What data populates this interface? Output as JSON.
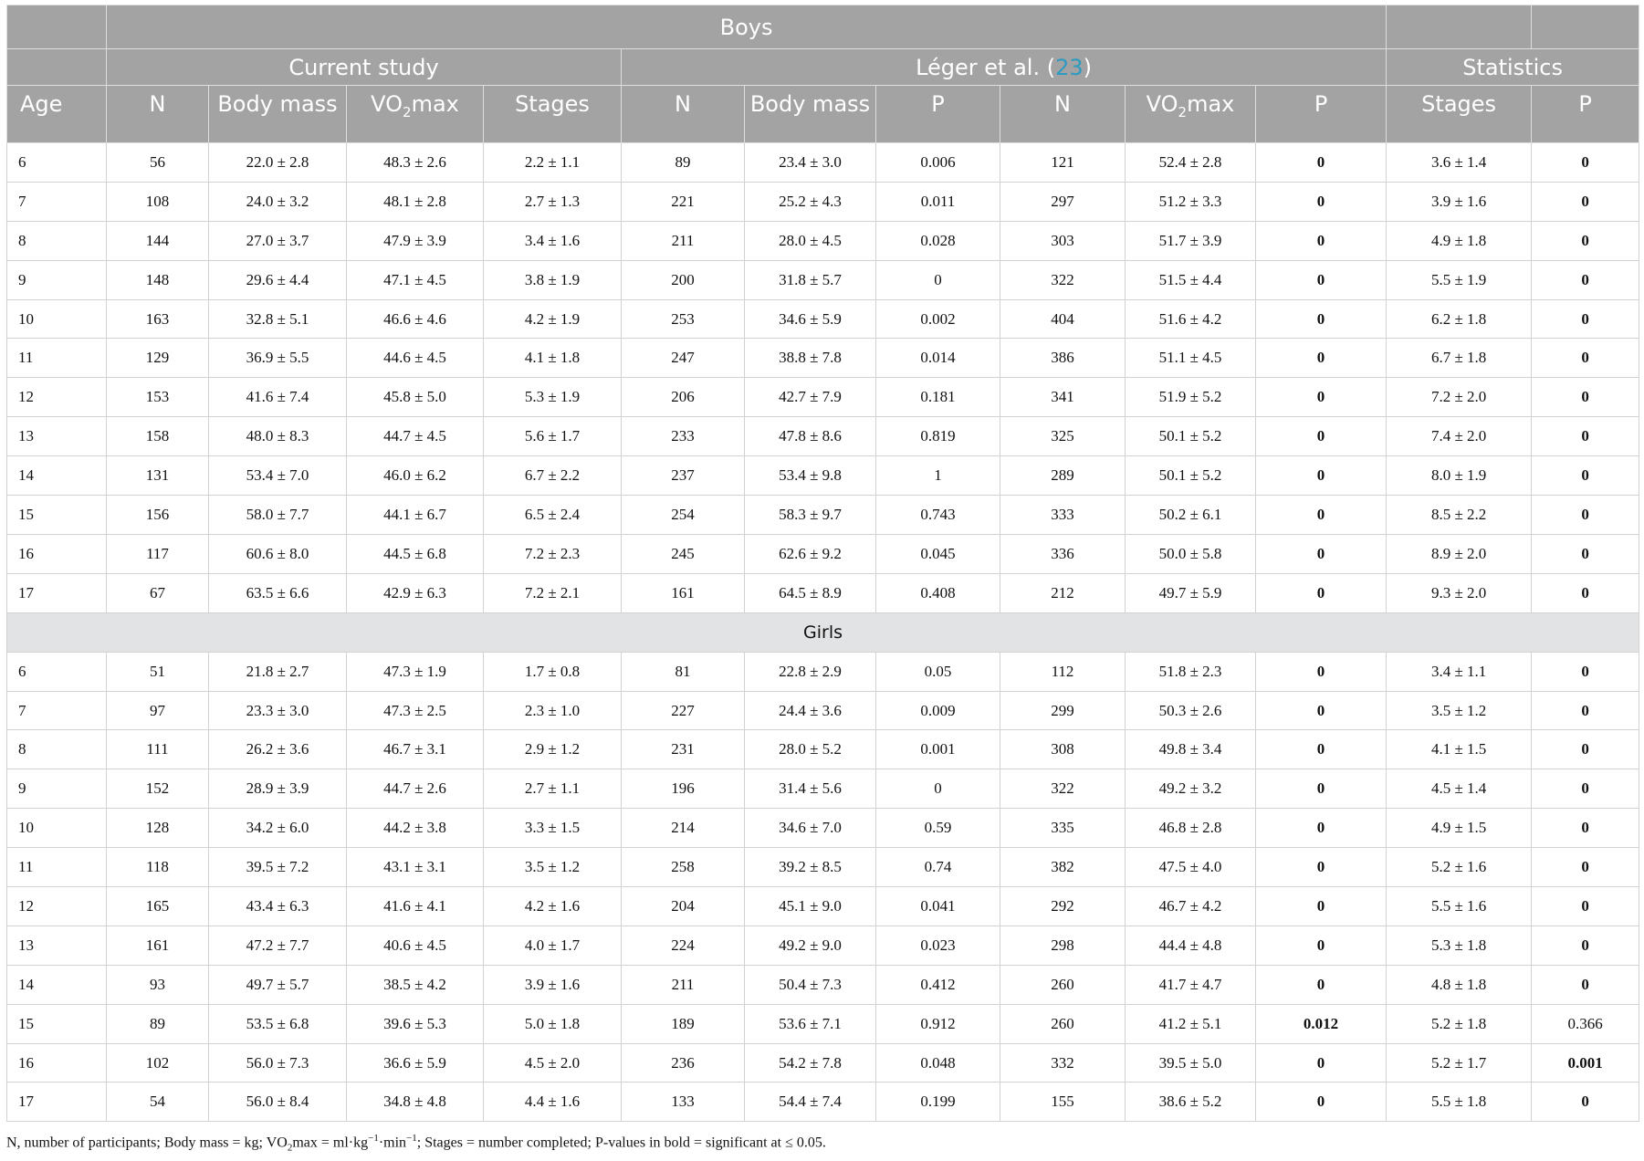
{
  "header": {
    "boys": "Boys",
    "current_study": "Current study",
    "leger_text": "Léger et al. (",
    "leger_ref": "23",
    "leger_close": ")",
    "statistics": "Statistics",
    "columns": {
      "age": "Age",
      "n1": "N",
      "body_mass_1": "Body mass",
      "vo2_prefix": "VO",
      "vo2_sub": "2",
      "vo2_suffix": "max",
      "stages1": "Stages",
      "n2": "N",
      "body_mass_2": "Body mass",
      "p1": "P",
      "n3": "N",
      "p2": "P",
      "stages2": "Stages",
      "p3": "P"
    }
  },
  "girls_label": "Girls",
  "boys_rows": [
    {
      "age": "6",
      "n": "56",
      "bm": "22.0 ± 2.8",
      "vo2": "48.3 ± 2.6",
      "st": "2.2 ± 1.1",
      "ln": "89",
      "lbm": "23.4 ± 3.0",
      "p1": "0.006",
      "ln2": "121",
      "lvo2": "52.4 ± 2.8",
      "p2": "0",
      "lst": "3.6 ± 1.4",
      "p3": "0"
    },
    {
      "age": "7",
      "n": "108",
      "bm": "24.0 ± 3.2",
      "vo2": "48.1 ± 2.8",
      "st": "2.7 ± 1.3",
      "ln": "221",
      "lbm": "25.2 ± 4.3",
      "p1": "0.011",
      "ln2": "297",
      "lvo2": "51.2 ± 3.3",
      "p2": "0",
      "lst": "3.9 ± 1.6",
      "p3": "0"
    },
    {
      "age": "8",
      "n": "144",
      "bm": "27.0 ± 3.7",
      "vo2": "47.9 ± 3.9",
      "st": "3.4 ± 1.6",
      "ln": "211",
      "lbm": "28.0 ± 4.5",
      "p1": "0.028",
      "ln2": "303",
      "lvo2": "51.7 ± 3.9",
      "p2": "0",
      "lst": "4.9 ± 1.8",
      "p3": "0"
    },
    {
      "age": "9",
      "n": "148",
      "bm": "29.6 ± 4.4",
      "vo2": "47.1 ± 4.5",
      "st": "3.8 ± 1.9",
      "ln": "200",
      "lbm": "31.8 ± 5.7",
      "p1": "0",
      "ln2": "322",
      "lvo2": "51.5 ± 4.4",
      "p2": "0",
      "lst": "5.5 ± 1.9",
      "p3": "0"
    },
    {
      "age": "10",
      "n": "163",
      "bm": "32.8 ± 5.1",
      "vo2": "46.6 ± 4.6",
      "st": "4.2 ± 1.9",
      "ln": "253",
      "lbm": "34.6 ± 5.9",
      "p1": "0.002",
      "ln2": "404",
      "lvo2": "51.6 ± 4.2",
      "p2": "0",
      "lst": "6.2 ± 1.8",
      "p3": "0"
    },
    {
      "age": "11",
      "n": "129",
      "bm": "36.9 ± 5.5",
      "vo2": "44.6 ± 4.5",
      "st": "4.1 ± 1.8",
      "ln": "247",
      "lbm": "38.8 ± 7.8",
      "p1": "0.014",
      "ln2": "386",
      "lvo2": "51.1 ± 4.5",
      "p2": "0",
      "lst": "6.7 ± 1.8",
      "p3": "0"
    },
    {
      "age": "12",
      "n": "153",
      "bm": "41.6 ± 7.4",
      "vo2": "45.8 ± 5.0",
      "st": "5.3 ± 1.9",
      "ln": "206",
      "lbm": "42.7 ± 7.9",
      "p1": "0.181",
      "ln2": "341",
      "lvo2": "51.9 ± 5.2",
      "p2": "0",
      "lst": "7.2 ± 2.0",
      "p3": "0"
    },
    {
      "age": "13",
      "n": "158",
      "bm": "48.0 ± 8.3",
      "vo2": "44.7 ± 4.5",
      "st": "5.6 ± 1.7",
      "ln": "233",
      "lbm": "47.8 ± 8.6",
      "p1": "0.819",
      "ln2": "325",
      "lvo2": "50.1 ± 5.2",
      "p2": "0",
      "lst": "7.4 ± 2.0",
      "p3": "0"
    },
    {
      "age": "14",
      "n": "131",
      "bm": "53.4 ± 7.0",
      "vo2": "46.0 ± 6.2",
      "st": "6.7 ± 2.2",
      "ln": "237",
      "lbm": "53.4 ± 9.8",
      "p1": "1",
      "ln2": "289",
      "lvo2": "50.1 ± 5.2",
      "p2": "0",
      "lst": "8.0 ± 1.9",
      "p3": "0"
    },
    {
      "age": "15",
      "n": "156",
      "bm": "58.0 ± 7.7",
      "vo2": "44.1 ± 6.7",
      "st": "6.5 ± 2.4",
      "ln": "254",
      "lbm": "58.3 ± 9.7",
      "p1": "0.743",
      "ln2": "333",
      "lvo2": "50.2 ± 6.1",
      "p2": "0",
      "lst": "8.5 ± 2.2",
      "p3": "0"
    },
    {
      "age": "16",
      "n": "117",
      "bm": "60.6 ± 8.0",
      "vo2": "44.5 ± 6.8",
      "st": "7.2 ± 2.3",
      "ln": "245",
      "lbm": "62.6 ± 9.2",
      "p1": "0.045",
      "ln2": "336",
      "lvo2": "50.0 ± 5.8",
      "p2": "0",
      "lst": "8.9 ± 2.0",
      "p3": "0"
    },
    {
      "age": "17",
      "n": "67",
      "bm": "63.5 ± 6.6",
      "vo2": "42.9 ± 6.3",
      "st": "7.2 ± 2.1",
      "ln": "161",
      "lbm": "64.5 ± 8.9",
      "p1": "0.408",
      "ln2": "212",
      "lvo2": "49.7 ± 5.9",
      "p2": "0",
      "lst": "9.3 ± 2.0",
      "p3": "0"
    }
  ],
  "girls_rows": [
    {
      "age": "6",
      "n": "51",
      "bm": "21.8 ± 2.7",
      "vo2": "47.3 ± 1.9",
      "st": "1.7 ± 0.8",
      "ln": "81",
      "lbm": "22.8 ± 2.9",
      "p1": "0.05",
      "ln2": "112",
      "lvo2": "51.8 ± 2.3",
      "p2": "0",
      "lst": "3.4 ± 1.1",
      "p3": "0"
    },
    {
      "age": "7",
      "n": "97",
      "bm": "23.3 ± 3.0",
      "vo2": "47.3 ± 2.5",
      "st": "2.3 ± 1.0",
      "ln": "227",
      "lbm": "24.4 ± 3.6",
      "p1": "0.009",
      "ln2": "299",
      "lvo2": "50.3 ± 2.6",
      "p2": "0",
      "lst": "3.5 ± 1.2",
      "p3": "0"
    },
    {
      "age": "8",
      "n": "111",
      "bm": "26.2 ± 3.6",
      "vo2": "46.7 ± 3.1",
      "st": "2.9 ± 1.2",
      "ln": "231",
      "lbm": "28.0 ± 5.2",
      "p1": "0.001",
      "ln2": "308",
      "lvo2": "49.8 ± 3.4",
      "p2": "0",
      "lst": "4.1 ± 1.5",
      "p3": "0"
    },
    {
      "age": "9",
      "n": "152",
      "bm": "28.9 ± 3.9",
      "vo2": "44.7 ± 2.6",
      "st": "2.7 ± 1.1",
      "ln": "196",
      "lbm": "31.4 ± 5.6",
      "p1": "0",
      "ln2": "322",
      "lvo2": "49.2 ± 3.2",
      "p2": "0",
      "lst": "4.5 ± 1.4",
      "p3": "0"
    },
    {
      "age": "10",
      "n": "128",
      "bm": "34.2 ± 6.0",
      "vo2": "44.2 ± 3.8",
      "st": "3.3 ± 1.5",
      "ln": "214",
      "lbm": "34.6 ± 7.0",
      "p1": "0.59",
      "ln2": "335",
      "lvo2": "46.8 ± 2.8",
      "p2": "0",
      "lst": "4.9 ± 1.5",
      "p3": "0"
    },
    {
      "age": "11",
      "n": "118",
      "bm": "39.5 ± 7.2",
      "vo2": "43.1 ± 3.1",
      "st": "3.5 ± 1.2",
      "ln": "258",
      "lbm": "39.2 ± 8.5",
      "p1": "0.74",
      "ln2": "382",
      "lvo2": "47.5 ± 4.0",
      "p2": "0",
      "lst": "5.2 ± 1.6",
      "p3": "0"
    },
    {
      "age": "12",
      "n": "165",
      "bm": "43.4 ± 6.3",
      "vo2": "41.6 ± 4.1",
      "st": "4.2 ± 1.6",
      "ln": "204",
      "lbm": "45.1 ± 9.0",
      "p1": "0.041",
      "ln2": "292",
      "lvo2": "46.7 ± 4.2",
      "p2": "0",
      "lst": "5.5 ± 1.6",
      "p3": "0"
    },
    {
      "age": "13",
      "n": "161",
      "bm": "47.2 ± 7.7",
      "vo2": "40.6 ± 4.5",
      "st": "4.0 ± 1.7",
      "ln": "224",
      "lbm": "49.2 ± 9.0",
      "p1": "0.023",
      "ln2": "298",
      "lvo2": "44.4 ± 4.8",
      "p2": "0",
      "lst": "5.3 ± 1.8",
      "p3": "0"
    },
    {
      "age": "14",
      "n": "93",
      "bm": "49.7 ± 5.7",
      "vo2": "38.5 ± 4.2",
      "st": "3.9 ± 1.6",
      "ln": "211",
      "lbm": "50.4 ± 7.3",
      "p1": "0.412",
      "ln2": "260",
      "lvo2": "41.7 ± 4.7",
      "p2": "0",
      "lst": "4.8 ± 1.8",
      "p3": "0"
    },
    {
      "age": "15",
      "n": "89",
      "bm": "53.5 ± 6.8",
      "vo2": "39.6 ± 5.3",
      "st": "5.0 ± 1.8",
      "ln": "189",
      "lbm": "53.6 ± 7.1",
      "p1": "0.912",
      "ln2": "260",
      "lvo2": "41.2 ± 5.1",
      "p2": "0.012",
      "lst": "5.2 ± 1.8",
      "p3": "0.366",
      "p3_plain": true
    },
    {
      "age": "16",
      "n": "102",
      "bm": "56.0 ± 7.3",
      "vo2": "36.6 ± 5.9",
      "st": "4.5 ± 2.0",
      "ln": "236",
      "lbm": "54.2 ± 7.8",
      "p1": "0.048",
      "ln2": "332",
      "lvo2": "39.5 ± 5.0",
      "p2": "0",
      "lst": "5.2 ± 1.7",
      "p3": "0.001"
    },
    {
      "age": "17",
      "n": "54",
      "bm": "56.0 ± 8.4",
      "vo2": "34.8 ± 4.8",
      "st": "4.4 ± 1.6",
      "ln": "133",
      "lbm": "54.4 ± 7.4",
      "p1": "0.199",
      "ln2": "155",
      "lvo2": "38.6 ± 5.2",
      "p2": "0",
      "lst": "5.5 ± 1.8",
      "p3": "0"
    }
  ],
  "footnote": {
    "part1": "N, number of participants; Body mass = kg; VO",
    "sub": "2",
    "part2": "max = ml·kg",
    "sup1": "−1",
    "part3": "·min",
    "sup2": "−1",
    "part4": "; Stages = number completed; P-values in bold = significant at ≤ 0.05."
  }
}
